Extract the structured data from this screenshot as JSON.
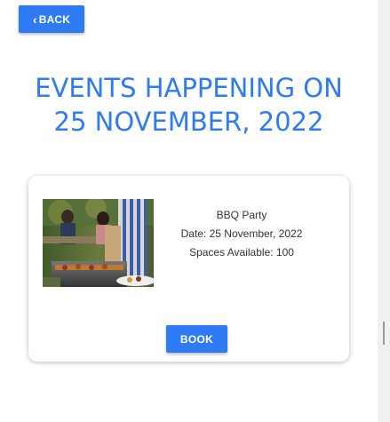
{
  "nav": {
    "back_label": "BACK",
    "back_icon": "chevron-left-icon"
  },
  "header": {
    "line1": "EVENTS HAPPENING ON",
    "line2": "25 NOVEMBER, 2022"
  },
  "event": {
    "name": "BBQ Party",
    "date": "Date: 25 November, 2022",
    "spaces": "Spaces Available: 100",
    "image": "bbq-party-photo",
    "book_label": "BOOK"
  },
  "colors": {
    "accent": "#2f7bf5",
    "text": "#333333"
  }
}
